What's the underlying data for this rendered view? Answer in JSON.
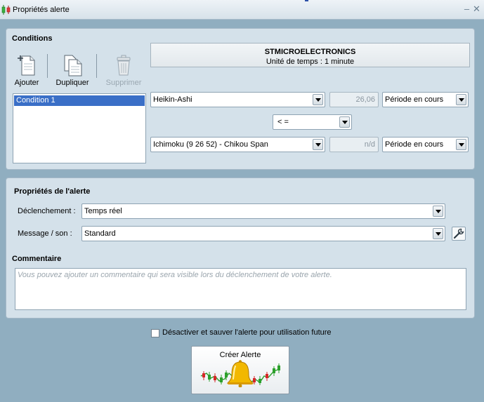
{
  "window": {
    "title": "Propriétés alerte",
    "icon": "candlestick-chart-icon",
    "buttons": {
      "minimize": "minimize-icon",
      "close": "close-icon"
    }
  },
  "conditions": {
    "title": "Conditions",
    "toolbar": {
      "add_label": "Ajouter",
      "duplicate_label": "Dupliquer",
      "delete_label": "Supprimer"
    },
    "list": [
      "Condition 1"
    ],
    "header": {
      "name": "STMICROELECTRONICS",
      "timeframe": "Unité de temps : 1 minute"
    },
    "row1": {
      "indicator": "Heikin-Ashi",
      "value": "26,06",
      "period": "Période en cours"
    },
    "operator": "< =",
    "row2": {
      "indicator": "Ichimoku (9 26 52) - Chikou Span",
      "value": "n/d",
      "period": "Période en cours"
    }
  },
  "alert_props": {
    "title": "Propriétés de l'alerte",
    "trigger_label": "Déclenchement :",
    "trigger_value": "Temps réel",
    "message_label": "Message / son :",
    "message_value": "Standard",
    "comment_title": "Commentaire",
    "comment_placeholder": "Vous pouvez ajouter un commentaire qui sera visible lors du déclenchement de votre alerte."
  },
  "footer": {
    "disable_label": "Désactiver et sauver l'alerte pour utilisation future",
    "disable_checked": false,
    "create_label": "Créer Alerte",
    "create_icon": "alert-bell-icon"
  },
  "colors": {
    "background": "#90aec0",
    "panel": "#d4e1ea",
    "selection": "#3a6fc7",
    "bell": "#f2b800",
    "candle_up": "#2ca02c",
    "candle_down": "#d62728"
  }
}
